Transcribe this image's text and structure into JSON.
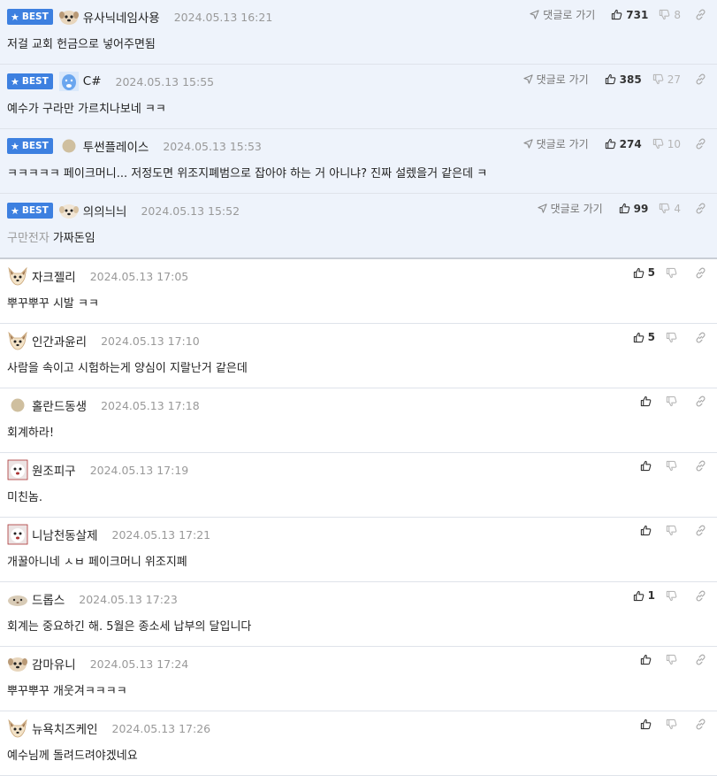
{
  "best_badge_label": "BEST",
  "goto_label": "댓글로 가기",
  "colors": {
    "best_bg": "#eef3fb",
    "badge": "#3d80e0"
  },
  "comments": [
    {
      "best": true,
      "nick": "유사닉네임사용",
      "date": "2024.05.13 16:21",
      "prefix": "",
      "text": "저걸 교회 헌금으로 넣어주면됨",
      "up": "731",
      "down": "8",
      "avatar": "dog-avatar"
    },
    {
      "best": true,
      "nick": "C#",
      "date": "2024.05.13 15:55",
      "prefix": "",
      "text": "예수가 구라만 가르치나보네 ㅋㅋ",
      "up": "385",
      "down": "27",
      "avatar": "blue-bear-avatar"
    },
    {
      "best": true,
      "nick": "투썬플레이스",
      "date": "2024.05.13 15:53",
      "prefix": "",
      "text": "ㅋㅋㅋㅋㅋ 페이크머니... 저정도면 위조지폐범으로 잡아야 하는 거 아니냐? 진짜 설렜을거 같은데 ㅋ",
      "up": "274",
      "down": "10",
      "avatar": "circle-avatar"
    },
    {
      "best": true,
      "nick": "의의늬늬",
      "date": "2024.05.13 15:52",
      "prefix": "구만전자",
      "text": "가짜돈임",
      "up": "99",
      "down": "4",
      "avatar": "puppy-avatar"
    },
    {
      "best": false,
      "nick": "자크젤리",
      "date": "2024.05.13 17:05",
      "prefix": "",
      "text": "뿌꾸뿌꾸 시발 ㅋㅋ",
      "up": "5",
      "down": "",
      "avatar": "fox-avatar"
    },
    {
      "best": false,
      "nick": "인간과윤리",
      "date": "2024.05.13 17:10",
      "prefix": "",
      "text": "사람을 속이고 시험하는게 양심이 지랄난거 같은데",
      "up": "5",
      "down": "",
      "avatar": "fox-avatar"
    },
    {
      "best": false,
      "nick": "홀란드동생",
      "date": "2024.05.13 17:18",
      "prefix": "",
      "text": "회계하라!",
      "up": "",
      "down": "",
      "avatar": "circle-avatar"
    },
    {
      "best": false,
      "nick": "원조피구",
      "date": "2024.05.13 17:19",
      "prefix": "",
      "text": "미친놈.",
      "up": "",
      "down": "",
      "avatar": "photo-avatar"
    },
    {
      "best": false,
      "nick": "니남천동살제",
      "date": "2024.05.13 17:21",
      "prefix": "",
      "text": "개꿀아니네 ㅅㅂ 페이크머니 위조지폐",
      "up": "",
      "down": "",
      "avatar": "photo-avatar"
    },
    {
      "best": false,
      "nick": "드롭스",
      "date": "2024.05.13 17:23",
      "prefix": "",
      "text": "회계는 중요하긴 해. 5월은 종소세 납부의 달입니다",
      "up": "1",
      "down": "",
      "avatar": "hamster-avatar"
    },
    {
      "best": false,
      "nick": "감마유니",
      "date": "2024.05.13 17:24",
      "prefix": "",
      "text": "뿌꾸뿌꾸 개웃겨ㅋㅋㅋㅋ",
      "up": "",
      "down": "",
      "avatar": "dog-avatar"
    },
    {
      "best": false,
      "nick": "뉴욕치즈케인",
      "date": "2024.05.13 17:26",
      "prefix": "",
      "text": "예수님께 돌려드려야겠네요",
      "up": "",
      "down": "",
      "avatar": "fox-avatar"
    }
  ]
}
